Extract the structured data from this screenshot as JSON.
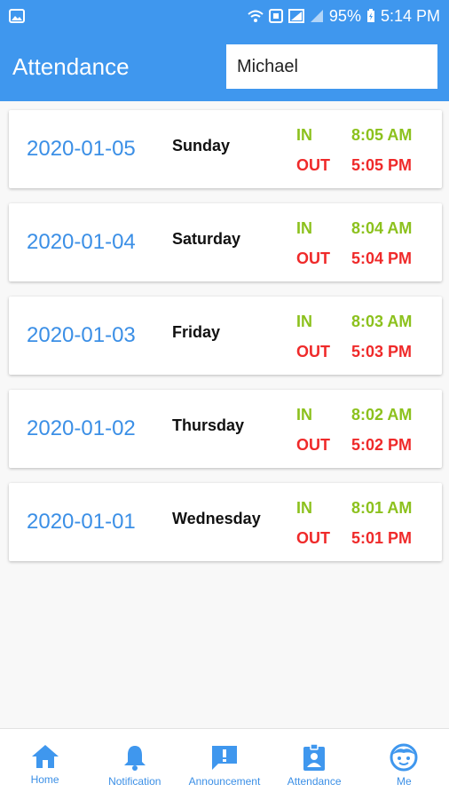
{
  "status_bar": {
    "battery": "95%",
    "time": "5:14 PM",
    "icons": [
      "image-icon",
      "wifi-icon",
      "nfc-icon",
      "signal-icon",
      "signal-icon",
      "battery-icon"
    ]
  },
  "header": {
    "title": "Attendance",
    "search_value": "Michael"
  },
  "records": [
    {
      "date": "2020-01-05",
      "day": "Sunday",
      "in_label": "IN",
      "in_time": "8:05 AM",
      "out_label": "OUT",
      "out_time": "5:05 PM"
    },
    {
      "date": "2020-01-04",
      "day": "Saturday",
      "in_label": "IN",
      "in_time": "8:04 AM",
      "out_label": "OUT",
      "out_time": "5:04 PM"
    },
    {
      "date": "2020-01-03",
      "day": "Friday",
      "in_label": "IN",
      "in_time": "8:03 AM",
      "out_label": "OUT",
      "out_time": "5:03 PM"
    },
    {
      "date": "2020-01-02",
      "day": "Thursday",
      "in_label": "IN",
      "in_time": "8:02 AM",
      "out_label": "OUT",
      "out_time": "5:02 PM"
    },
    {
      "date": "2020-01-01",
      "day": "Wednesday",
      "in_label": "IN",
      "in_time": "8:01 AM",
      "out_label": "OUT",
      "out_time": "5:01 PM"
    }
  ],
  "bottom_nav": [
    {
      "label": "Home",
      "icon": "home-icon"
    },
    {
      "label": "Notification",
      "icon": "bell-icon"
    },
    {
      "label": "Announcement",
      "icon": "announcement-icon"
    },
    {
      "label": "Attendance",
      "icon": "badge-icon"
    },
    {
      "label": "Me",
      "icon": "face-icon"
    }
  ],
  "colors": {
    "primary": "#3f97ee",
    "date": "#3b8fe6",
    "in": "#8cc11d",
    "out": "#ef2a2a"
  }
}
